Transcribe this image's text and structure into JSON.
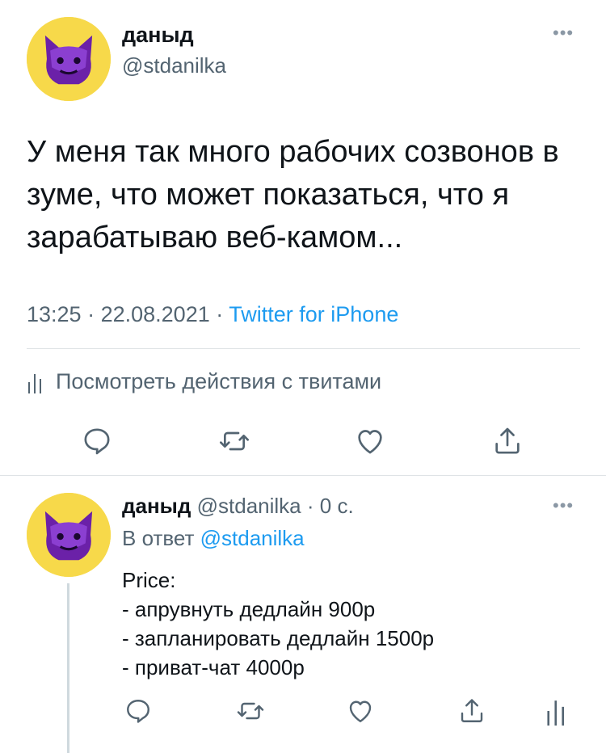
{
  "main_tweet": {
    "display_name": "даныд",
    "handle": "@stdanilka",
    "text": "У меня так много рабочих созвонов в зуме, что может показаться, что я зарабатываю веб-камом...",
    "time": "13:25",
    "date": "22.08.2021",
    "source": "Twitter for iPhone",
    "analytics_label": "Посмотреть действия с твитами",
    "more_icon": "more-icon"
  },
  "reply_tweet": {
    "display_name": "даныд",
    "handle": "@stdanilka",
    "age": "0 с.",
    "reply_prefix": "В ответ",
    "reply_to": "@stdanilka",
    "lines": [
      "Price:",
      "- апрувнуть дедлайн 900р",
      "- запланировать дедлайн 1500р",
      "- приват-чат 4000р"
    ]
  },
  "colors": {
    "accent": "#1d9bf0",
    "secondary_text": "#536471",
    "avatar_bg": "#f7d94a",
    "avatar_figure": "#6b21a8"
  }
}
